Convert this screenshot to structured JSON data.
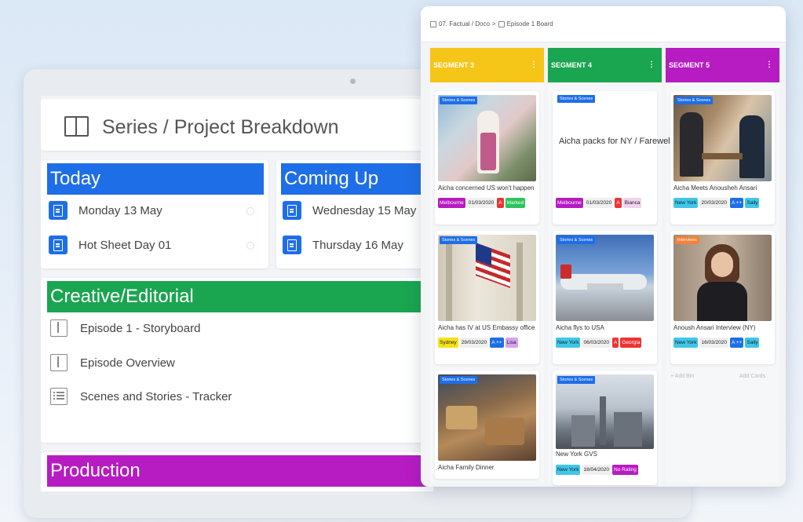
{
  "project": {
    "title": "Series / Project Breakdown"
  },
  "today": {
    "label": "Today",
    "items": [
      "Monday 13 May",
      "Hot Sheet Day 01"
    ]
  },
  "coming_up": {
    "label": "Coming Up",
    "items": [
      "Wednesday 15 May",
      "Thursday 16 May"
    ]
  },
  "creative": {
    "label": "Creative/Editorial",
    "items": [
      "Episode 1 - Storyboard",
      "Episode Overview",
      "Scenes and Stories - Tracker"
    ]
  },
  "production": {
    "label": "Production"
  },
  "board": {
    "breadcrumb_root": "07. Factual / Doco",
    "breadcrumb_sep": ">",
    "breadcrumb_page": "Episode 1 Board",
    "columns": [
      {
        "title": "SEGMENT 3",
        "color": "#f5c518",
        "menu": "⋮"
      },
      {
        "title": "SEGMENT 4",
        "color": "#1aa550",
        "menu": "⋮"
      },
      {
        "title": "SEGMENT 5",
        "color": "#b71bc2",
        "menu": "⋮"
      }
    ],
    "cards": {
      "c1": {
        "tag": "Stories & Scenes",
        "caption": "Aicha concerned US won't happen",
        "chips": [
          "Melbourne",
          "01/03/2020",
          "A",
          "Marked"
        ]
      },
      "c2": {
        "tag": "Stories & Scenes",
        "caption": "Aicha has IV at US Embassy office",
        "chips": [
          "Sydney",
          "29/03/2020",
          "A ++",
          "Lisa"
        ]
      },
      "c3": {
        "tag": "Stories & Scenes",
        "caption": "Aicha Family Dinner"
      },
      "c4": {
        "tag": "Stories & Scenes",
        "caption": "Aicha packs for NY / Farewell",
        "chips": [
          "Melbourne",
          "01/03/2020",
          "A",
          "Bianca"
        ]
      },
      "c5": {
        "tag": "Stories & Scenes",
        "caption": "Aicha flys to USA",
        "chips": [
          "New York",
          "06/03/2020",
          "A",
          "Georgia"
        ]
      },
      "c6": {
        "tag": "Stories & Scenes",
        "caption": "New York GVS",
        "chips": [
          "New York",
          "18/04/2020",
          "No Rating"
        ]
      },
      "c7": {
        "tag": "Stories & Scenes",
        "caption": "Aicha Meets Anousheh Ansari",
        "chips": [
          "New York",
          "20/03/2020",
          "A ++",
          "Sally"
        ]
      },
      "c8": {
        "tag": "Interviews",
        "caption": "Anoush Ansari Interview (NY)",
        "chips": [
          "New York",
          "16/03/2020",
          "A ++",
          "Sally"
        ]
      }
    },
    "add_list": "+ Add Bin",
    "add_card": "Add Cards"
  },
  "colors": {
    "blue": "#1e6ee8",
    "green": "#1aa550",
    "purple": "#b71bc2",
    "yellow": "#f5c518"
  },
  "icons": [
    "book-icon",
    "document-icon",
    "list-icon",
    "home-icon"
  ]
}
